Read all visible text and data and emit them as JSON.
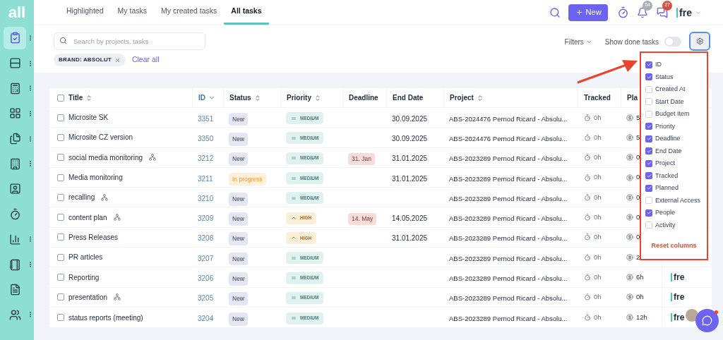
{
  "sidebar": {
    "logo": "all",
    "items": [
      {
        "selected": true,
        "menu": true
      },
      {
        "selected": false,
        "menu": true
      },
      {
        "selected": false,
        "menu": true
      },
      {
        "selected": false,
        "menu": true
      },
      {
        "selected": false,
        "menu": true
      },
      {
        "selected": false,
        "menu": true
      },
      {
        "selected": false,
        "menu": false
      },
      {
        "selected": false,
        "menu": false
      },
      {
        "selected": false,
        "menu": true
      },
      {
        "selected": false,
        "menu": true
      },
      {
        "selected": false,
        "menu": false
      },
      {
        "selected": false,
        "menu": true
      }
    ]
  },
  "tabs": [
    {
      "label": "Highlighted",
      "selected": false
    },
    {
      "label": "My tasks",
      "selected": false
    },
    {
      "label": "My created tasks",
      "selected": false
    },
    {
      "label": "All tasks",
      "selected": true
    }
  ],
  "header": {
    "new_button": "New",
    "notifications_badge": "54",
    "messages_badge": "27",
    "account": "fre"
  },
  "search": {
    "placeholder": "Search by projects, tasks"
  },
  "filter_chips": [
    {
      "label": "BRAND: ABSOLUT"
    }
  ],
  "clear_all": "Clear all",
  "filters_button": "Filters",
  "show_done": {
    "label": "Show done tasks",
    "on": false
  },
  "table": {
    "select_all": false,
    "columns": [
      {
        "label": "Title",
        "kind": "sortable"
      },
      {
        "label": "ID",
        "kind": "sorted"
      },
      {
        "label": "Status",
        "kind": "sortable"
      },
      {
        "label": "Priority",
        "kind": "sortable"
      },
      {
        "label": "Deadline",
        "kind": "plain"
      },
      {
        "label": "End Date",
        "kind": "plain"
      },
      {
        "label": "Project",
        "kind": "sortable"
      },
      {
        "label": "Tracked",
        "kind": "plain"
      },
      {
        "label": "Pla",
        "kind": "plain"
      }
    ],
    "rows": [
      {
        "title": "Microsite SK",
        "selected": false,
        "subtasks": false,
        "id": "3351",
        "status": {
          "label": "New",
          "kind": "new"
        },
        "priority": {
          "label": "MEDIUM",
          "kind": "medium"
        },
        "end_date": "30.09.2025",
        "project": "ABS-2024476 Pernod Ricard - Absolu...",
        "tracked": "0h",
        "planned": "5"
      },
      {
        "title": "Microsite CZ version",
        "selected": false,
        "subtasks": false,
        "id": "3350",
        "status": {
          "label": "New",
          "kind": "new"
        },
        "priority": {
          "label": "MEDIUM",
          "kind": "medium"
        },
        "end_date": "30.09.2025",
        "project": "ABS-2024476 Pernod Ricard - Absolu...",
        "tracked": "0h",
        "planned": "5"
      },
      {
        "title": "social media monitoring",
        "selected": false,
        "subtasks": true,
        "id": "3212",
        "status": {
          "label": "New",
          "kind": "new"
        },
        "priority": {
          "label": "MEDIUM",
          "kind": "medium"
        },
        "deadline": "31. Jan",
        "end_date": "31.01.2025",
        "project": "ABS-2023289 Pernod Ricard - Absolu...",
        "tracked": "0h",
        "planned": "0"
      },
      {
        "title": "Media monitoring",
        "selected": false,
        "subtasks": false,
        "id": "3211",
        "status": {
          "label": "In progress",
          "kind": "progress"
        },
        "priority": {
          "label": "MEDIUM",
          "kind": "medium"
        },
        "end_date": "31.01.2025",
        "project": "ABS-2023289 Pernod Ricard - Absolu...",
        "tracked": "0h",
        "planned": "0"
      },
      {
        "title": "recalling",
        "selected": false,
        "subtasks": true,
        "id": "3210",
        "status": {
          "label": "New",
          "kind": "new"
        },
        "priority": {
          "label": "MEDIUM",
          "kind": "medium"
        },
        "project": "ABS-2023289 Pernod Ricard - Absolu...",
        "tracked": "0h",
        "planned": "0"
      },
      {
        "title": "content plan",
        "selected": false,
        "subtasks": true,
        "id": "3209",
        "status": {
          "label": "New",
          "kind": "new"
        },
        "priority": {
          "label": "HIGH",
          "kind": "high"
        },
        "deadline": "14. May",
        "end_date": "14.05.2025",
        "project": "ABS-2023289 Pernod Ricard - Absolu...",
        "tracked": "0h",
        "planned": "0"
      },
      {
        "title": "Press Releases",
        "selected": false,
        "subtasks": false,
        "id": "3208",
        "status": {
          "label": "New",
          "kind": "new"
        },
        "priority": {
          "label": "HIGH",
          "kind": "high"
        },
        "end_date": "31.01.2025",
        "project": "ABS-2023289 Pernod Ricard - Absolu...",
        "tracked": "0h",
        "planned": "0"
      },
      {
        "title": "PR articles",
        "selected": false,
        "subtasks": false,
        "id": "3207",
        "status": {
          "label": "New",
          "kind": "new"
        },
        "priority": {
          "label": "MEDIUM",
          "kind": "medium"
        },
        "project": "ABS-2023289 Pernod Ricard - Absolu...",
        "tracked": "0h",
        "planned": "2"
      },
      {
        "title": "Reporting",
        "selected": false,
        "subtasks": false,
        "id": "3206",
        "status": {
          "label": "New",
          "kind": "new"
        },
        "priority": {
          "label": "MEDIUM",
          "kind": "medium"
        },
        "project": "ABS-2023289 Pernod Ricard - Absolu...",
        "tracked": "0h",
        "planned": "6h",
        "people": "fre"
      },
      {
        "title": "presentation",
        "selected": false,
        "subtasks": true,
        "id": "3205",
        "status": {
          "label": "New",
          "kind": "new"
        },
        "priority": {
          "label": "MEDIUM",
          "kind": "medium"
        },
        "project": "ABS-2023289 Pernod Ricard - Absolu...",
        "tracked": "0h",
        "planned": "0h",
        "people": "fre"
      },
      {
        "title": "status reports (meeting)",
        "selected": false,
        "subtasks": false,
        "id": "3204",
        "status": {
          "label": "New",
          "kind": "new"
        },
        "priority": {
          "label": "MEDIUM",
          "kind": "medium"
        },
        "project": "ABS-2023289 Pernod Ricard - Absolu...",
        "tracked": "0h",
        "planned": "12h",
        "people": "fre"
      }
    ]
  },
  "column_menu": {
    "items": [
      {
        "label": "ID",
        "checked": true
      },
      {
        "label": "Status",
        "checked": true
      },
      {
        "label": "Created At",
        "checked": false
      },
      {
        "label": "Start Date",
        "checked": false
      },
      {
        "label": "Budget Item",
        "checked": false
      },
      {
        "label": "Priority",
        "checked": true
      },
      {
        "label": "Deadline",
        "checked": true
      },
      {
        "label": "End Date",
        "checked": true
      },
      {
        "label": "Project",
        "checked": true
      },
      {
        "label": "Tracked",
        "checked": true
      },
      {
        "label": "Planned",
        "checked": true
      },
      {
        "label": "External Access",
        "checked": false
      },
      {
        "label": "People",
        "checked": true
      },
      {
        "label": "Activity",
        "checked": false
      }
    ],
    "reset": "Reset columns"
  }
}
